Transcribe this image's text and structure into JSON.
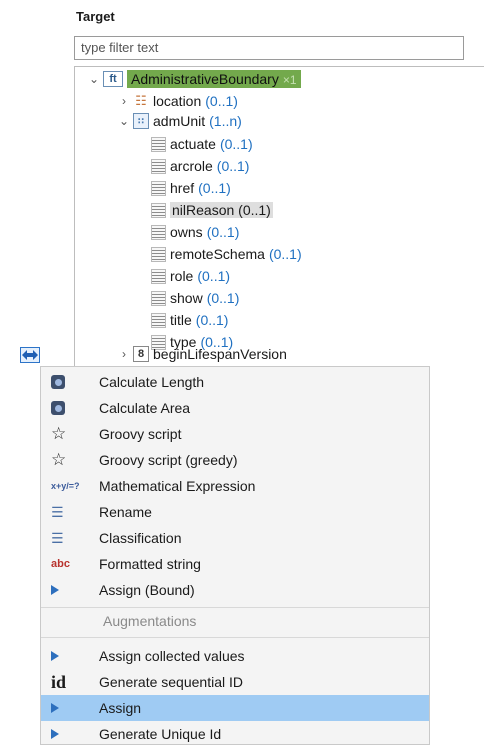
{
  "panel": {
    "title": "Target",
    "filter_placeholder": "type filter text"
  },
  "tree": {
    "root": {
      "icon": "ft",
      "label": "AdministrativeBoundary",
      "suffix": "×1"
    },
    "location": {
      "label": "location",
      "mult": "(0..1)"
    },
    "admUnit": {
      "label": "admUnit",
      "mult": "(1..n)"
    },
    "attrs": [
      {
        "label": "actuate",
        "mult": "(0..1)"
      },
      {
        "label": "arcrole",
        "mult": "(0..1)"
      },
      {
        "label": "href",
        "mult": "(0..1)"
      },
      {
        "label": "nilReason",
        "mult": "(0..1)"
      },
      {
        "label": "owns",
        "mult": "(0..1)"
      },
      {
        "label": "remoteSchema",
        "mult": "(0..1)"
      },
      {
        "label": "role",
        "mult": "(0..1)"
      },
      {
        "label": "show",
        "mult": "(0..1)"
      },
      {
        "label": "title",
        "mult": "(0..1)"
      },
      {
        "label": "type",
        "mult": "(0..1)"
      }
    ],
    "beginLifespan": {
      "icon": "8",
      "label": "beginLifespanVersion"
    }
  },
  "menu": {
    "items": [
      {
        "label": "Calculate Length",
        "icon": "circle-gear-icon"
      },
      {
        "label": "Calculate Area",
        "icon": "circle-gear-icon"
      },
      {
        "label": "Groovy script",
        "icon": "star-icon"
      },
      {
        "label": "Groovy script (greedy)",
        "icon": "star-icon"
      },
      {
        "label": "Mathematical Expression",
        "icon": "math-icon",
        "glyph": "x+y/=?"
      },
      {
        "label": "Rename",
        "icon": "list-icon"
      },
      {
        "label": "Classification",
        "icon": "list-icon"
      },
      {
        "label": "Formatted string",
        "icon": "abc-icon",
        "glyph": "abc"
      },
      {
        "label": "Assign (Bound)",
        "icon": "arrow-icon"
      }
    ],
    "section_label": "Augmentations",
    "aug_items": [
      {
        "label": "Assign collected values",
        "icon": "arrow-icon"
      },
      {
        "label": "Generate sequential ID",
        "icon": "id-icon",
        "glyph": "id"
      },
      {
        "label": "Assign",
        "icon": "arrow-icon"
      },
      {
        "label": "Generate Unique Id",
        "icon": "arrow-icon"
      }
    ],
    "selected_label": "Assign"
  },
  "colors": {
    "accent": "#1f70c1",
    "highlight_green": "#73a94c",
    "selected": "#9fcbf3"
  }
}
